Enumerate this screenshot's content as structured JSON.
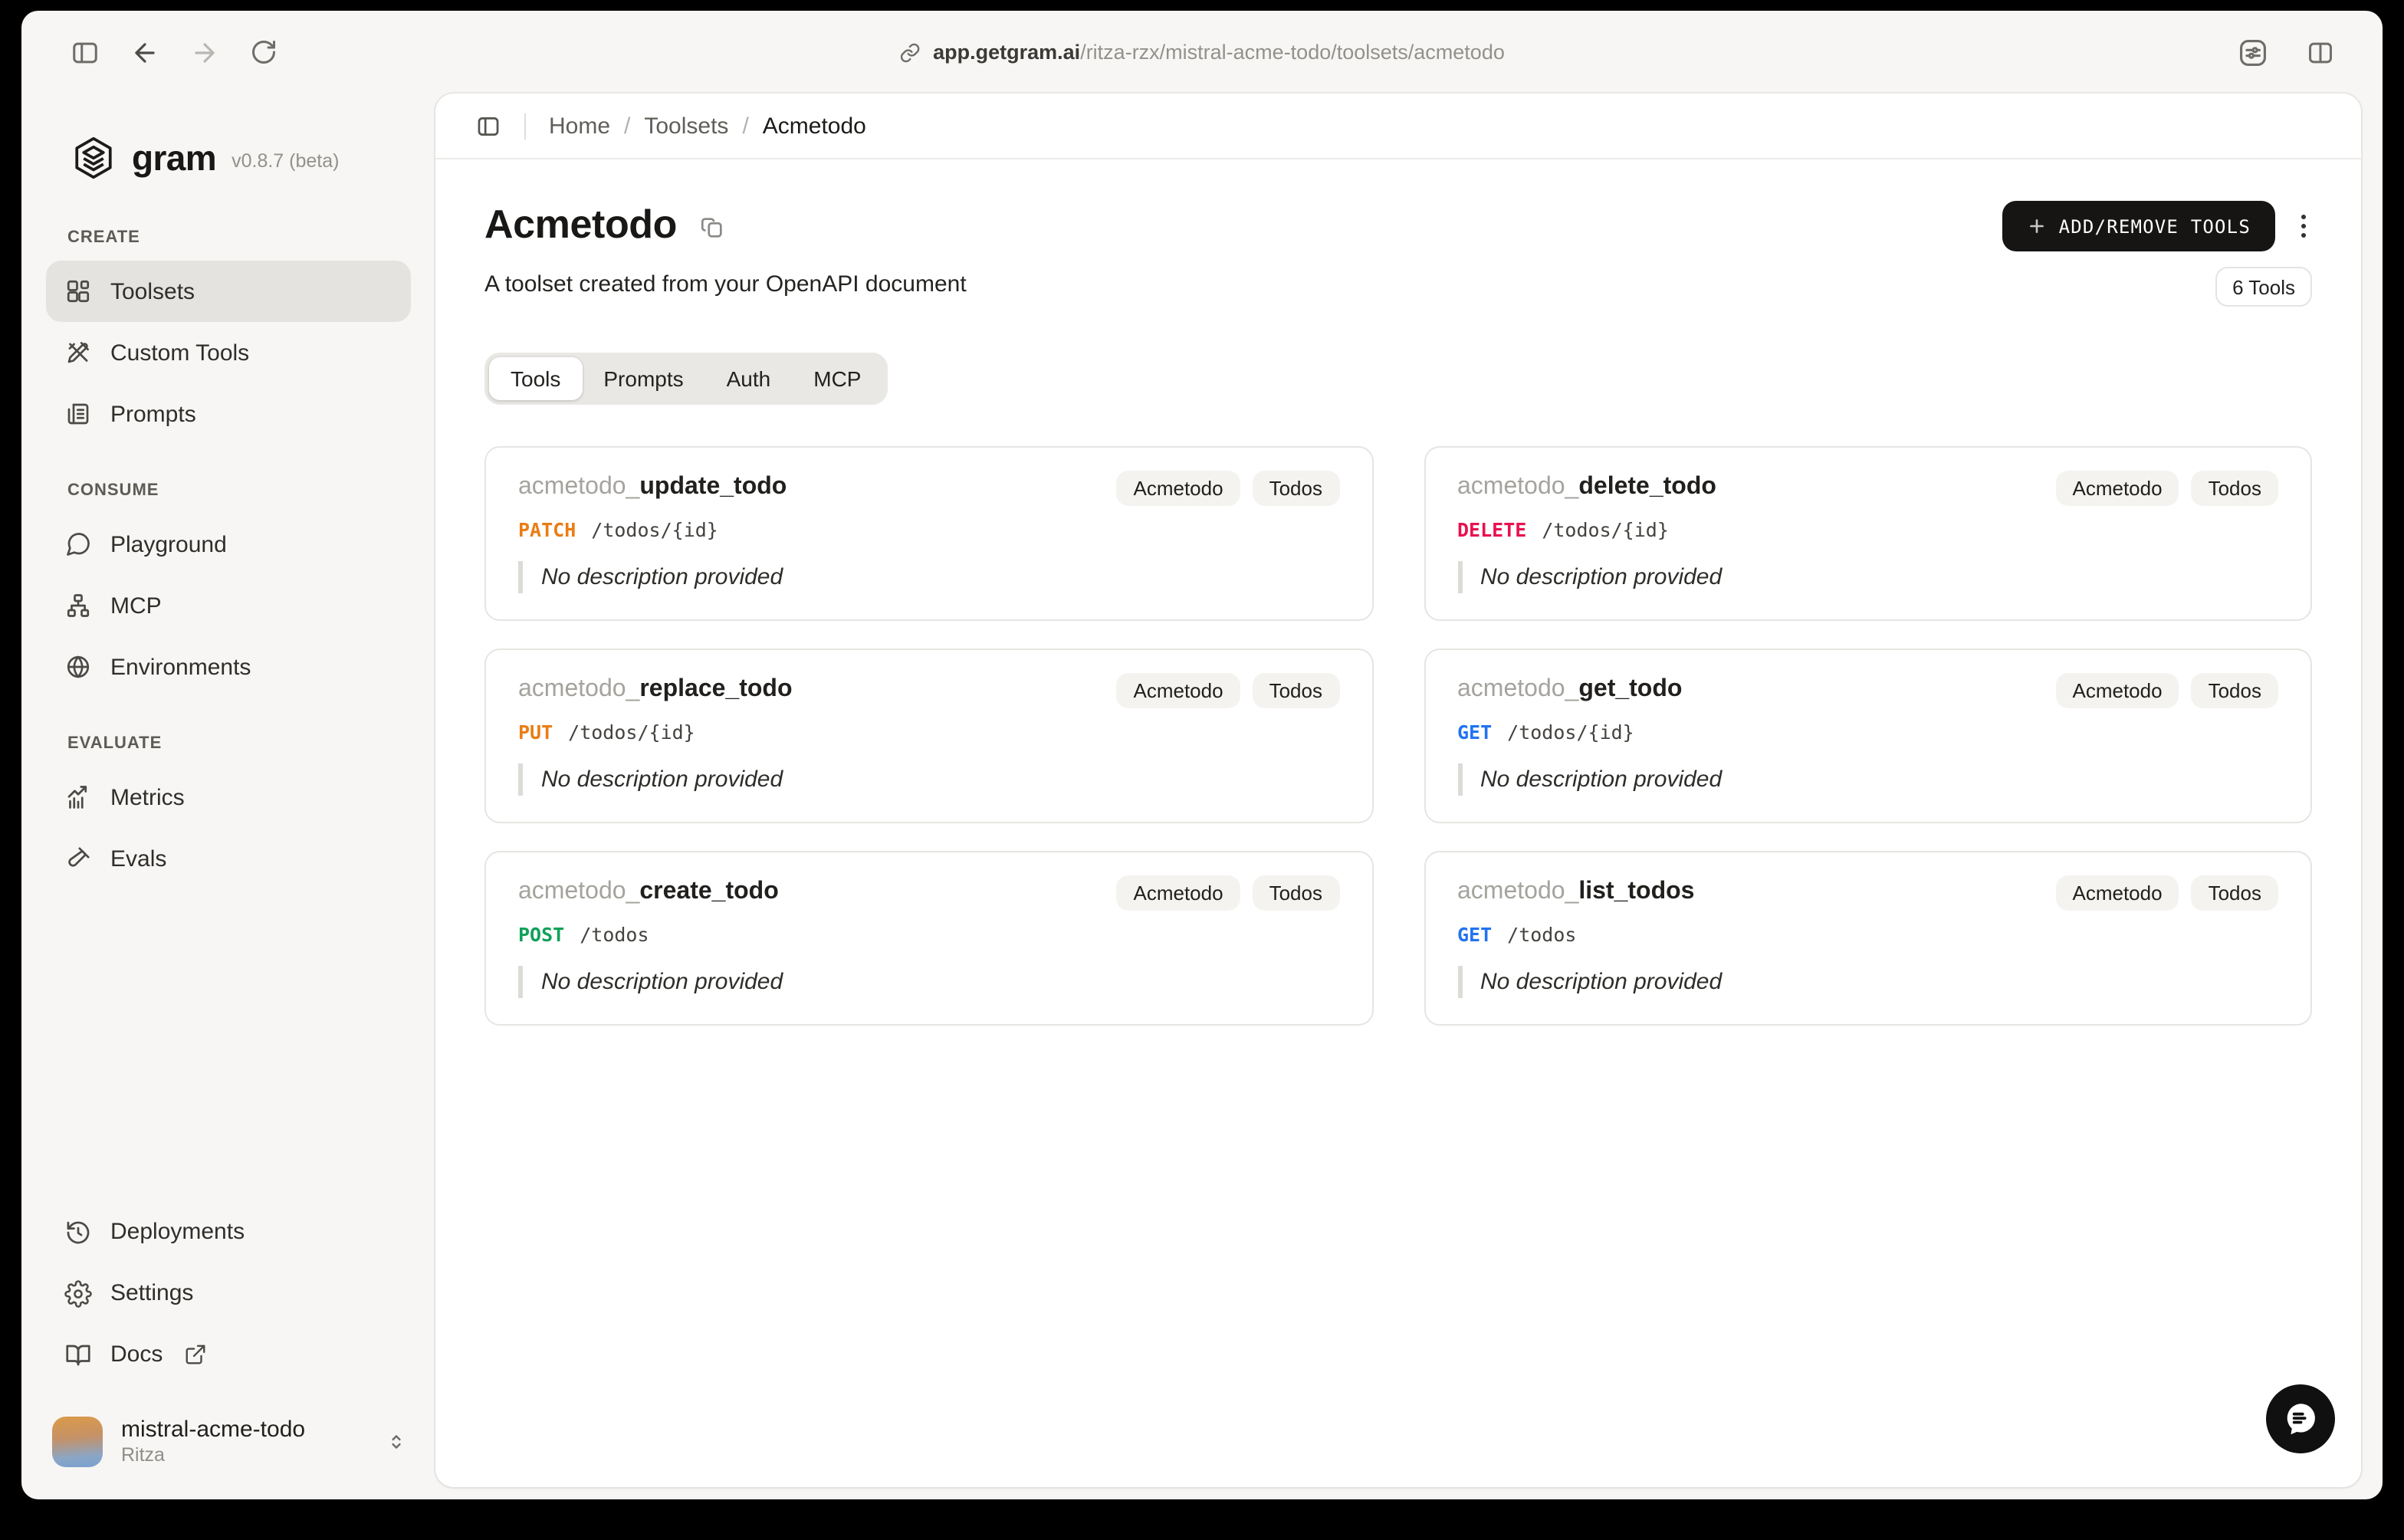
{
  "browser": {
    "url_domain": "app.getgram.ai",
    "url_path": "/ritza-rzx/mistral-acme-todo/toolsets/acmetodo"
  },
  "sidebar": {
    "logo_text": "gram",
    "version": "v0.8.7 (beta)",
    "sections": [
      {
        "label": "CREATE",
        "items": [
          {
            "label": "Toolsets",
            "icon": "blocks-icon",
            "active": true
          },
          {
            "label": "Custom Tools",
            "icon": "crossed-tools-icon",
            "active": false
          },
          {
            "label": "Prompts",
            "icon": "newspaper-icon",
            "active": false
          }
        ]
      },
      {
        "label": "CONSUME",
        "items": [
          {
            "label": "Playground",
            "icon": "chat-bubble-icon",
            "active": false
          },
          {
            "label": "MCP",
            "icon": "hierarchy-icon",
            "active": false
          },
          {
            "label": "Environments",
            "icon": "globe-icon",
            "active": false
          }
        ]
      },
      {
        "label": "EVALUATE",
        "items": [
          {
            "label": "Metrics",
            "icon": "chart-icon",
            "active": false
          },
          {
            "label": "Evals",
            "icon": "test-tube-icon",
            "active": false
          }
        ]
      }
    ],
    "footer_items": [
      {
        "label": "Deployments",
        "icon": "history-icon"
      },
      {
        "label": "Settings",
        "icon": "gear-icon"
      },
      {
        "label": "Docs",
        "icon": "book-icon",
        "external": true
      }
    ],
    "account": {
      "name": "mistral-acme-todo",
      "org": "Ritza"
    }
  },
  "breadcrumb": {
    "separator": "/",
    "items": [
      "Home",
      "Toolsets",
      "Acmetodo"
    ]
  },
  "page": {
    "title": "Acmetodo",
    "subtitle": "A toolset created from your OpenAPI document",
    "add_remove_button": "ADD/REMOVE TOOLS",
    "tools_count_badge": "6 Tools"
  },
  "tabs": [
    {
      "label": "Tools",
      "active": true
    },
    {
      "label": "Prompts",
      "active": false
    },
    {
      "label": "Auth",
      "active": false
    },
    {
      "label": "MCP",
      "active": false
    }
  ],
  "colors": {
    "add_button_bg": "#161514",
    "method_get": "#2273f0",
    "method_post": "#0fa158",
    "method_put": "#ea7d14",
    "method_patch": "#ea7d14",
    "method_delete": "#e81050"
  },
  "cards": [
    {
      "prefix": "acmetodo_",
      "name": "update_todo",
      "method": "PATCH",
      "method_color": "#ea7d14",
      "path": "/todos/{id}",
      "badges": [
        "Acmetodo",
        "Todos"
      ],
      "description": "No description provided"
    },
    {
      "prefix": "acmetodo_",
      "name": "delete_todo",
      "method": "DELETE",
      "method_color": "#e81050",
      "path": "/todos/{id}",
      "badges": [
        "Acmetodo",
        "Todos"
      ],
      "description": "No description provided"
    },
    {
      "prefix": "acmetodo_",
      "name": "replace_todo",
      "method": "PUT",
      "method_color": "#ea7d14",
      "path": "/todos/{id}",
      "badges": [
        "Acmetodo",
        "Todos"
      ],
      "description": "No description provided"
    },
    {
      "prefix": "acmetodo_",
      "name": "get_todo",
      "method": "GET",
      "method_color": "#2273f0",
      "path": "/todos/{id}",
      "badges": [
        "Acmetodo",
        "Todos"
      ],
      "description": "No description provided"
    },
    {
      "prefix": "acmetodo_",
      "name": "create_todo",
      "method": "POST",
      "method_color": "#0fa158",
      "path": "/todos",
      "badges": [
        "Acmetodo",
        "Todos"
      ],
      "description": "No description provided"
    },
    {
      "prefix": "acmetodo_",
      "name": "list_todos",
      "method": "GET",
      "method_color": "#2273f0",
      "path": "/todos",
      "badges": [
        "Acmetodo",
        "Todos"
      ],
      "description": "No description provided"
    }
  ]
}
